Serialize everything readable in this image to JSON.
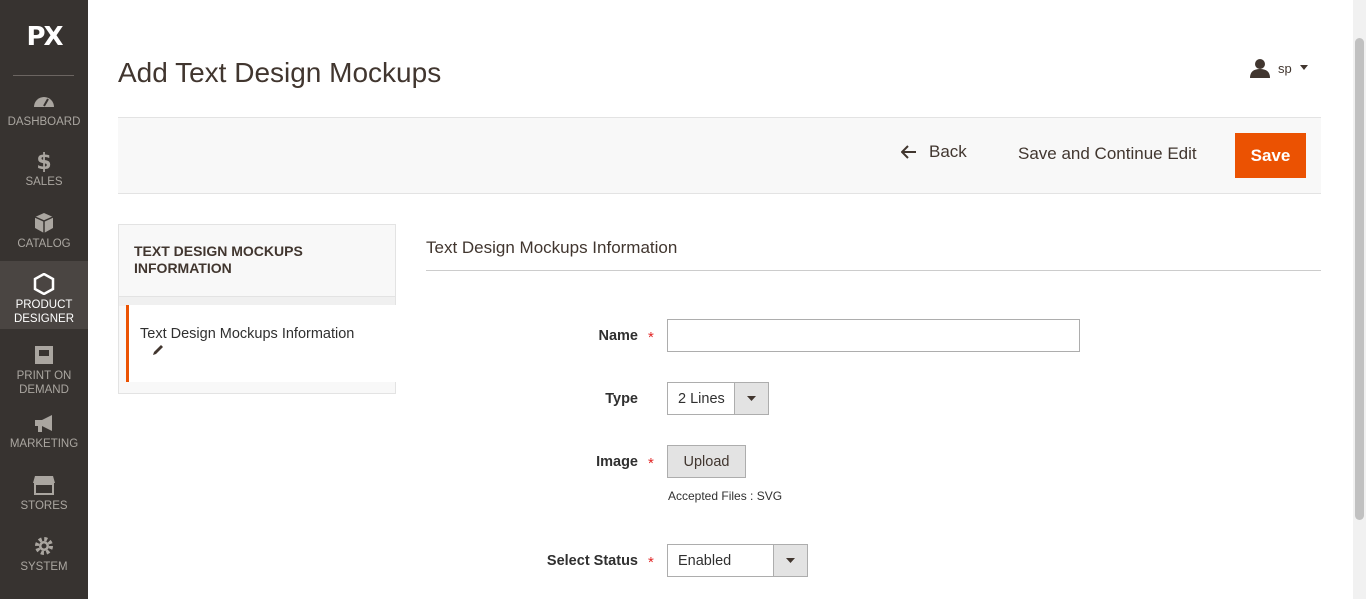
{
  "app": {
    "logo": "PX"
  },
  "sidebar": {
    "items": [
      {
        "label": "DASHBOARD",
        "icon": "dashboard-icon"
      },
      {
        "label": "SALES",
        "icon": "dollar-icon"
      },
      {
        "label": "CATALOG",
        "icon": "box-icon"
      },
      {
        "label": "PRODUCT DESIGNER",
        "icon": "hexagon-icon",
        "active": true
      },
      {
        "label": "PRINT ON DEMAND",
        "icon": "printer-icon"
      },
      {
        "label": "MARKETING",
        "icon": "megaphone-icon"
      },
      {
        "label": "STORES",
        "icon": "store-icon"
      },
      {
        "label": "SYSTEM",
        "icon": "gear-icon"
      }
    ]
  },
  "header": {
    "title": "Add Text Design Mockups",
    "user": "sp"
  },
  "actions": {
    "back": "Back",
    "save_continue": "Save and Continue Edit",
    "save": "Save"
  },
  "tabs": {
    "title": "TEXT DESIGN MOCKUPS INFORMATION",
    "items": [
      {
        "label": "Text Design Mockups Information"
      }
    ]
  },
  "form": {
    "section_title": "Text Design Mockups Information",
    "name": {
      "label": "Name",
      "value": "",
      "required": true
    },
    "type": {
      "label": "Type",
      "value": "2 Lines"
    },
    "image": {
      "label": "Image",
      "button": "Upload",
      "hint": "Accepted Files : SVG",
      "required": true
    },
    "status": {
      "label": "Select Status",
      "value": "Enabled",
      "required": true
    }
  },
  "colors": {
    "accent": "#eb5202",
    "sidebar_bg": "#373330",
    "required": "#e22626"
  }
}
